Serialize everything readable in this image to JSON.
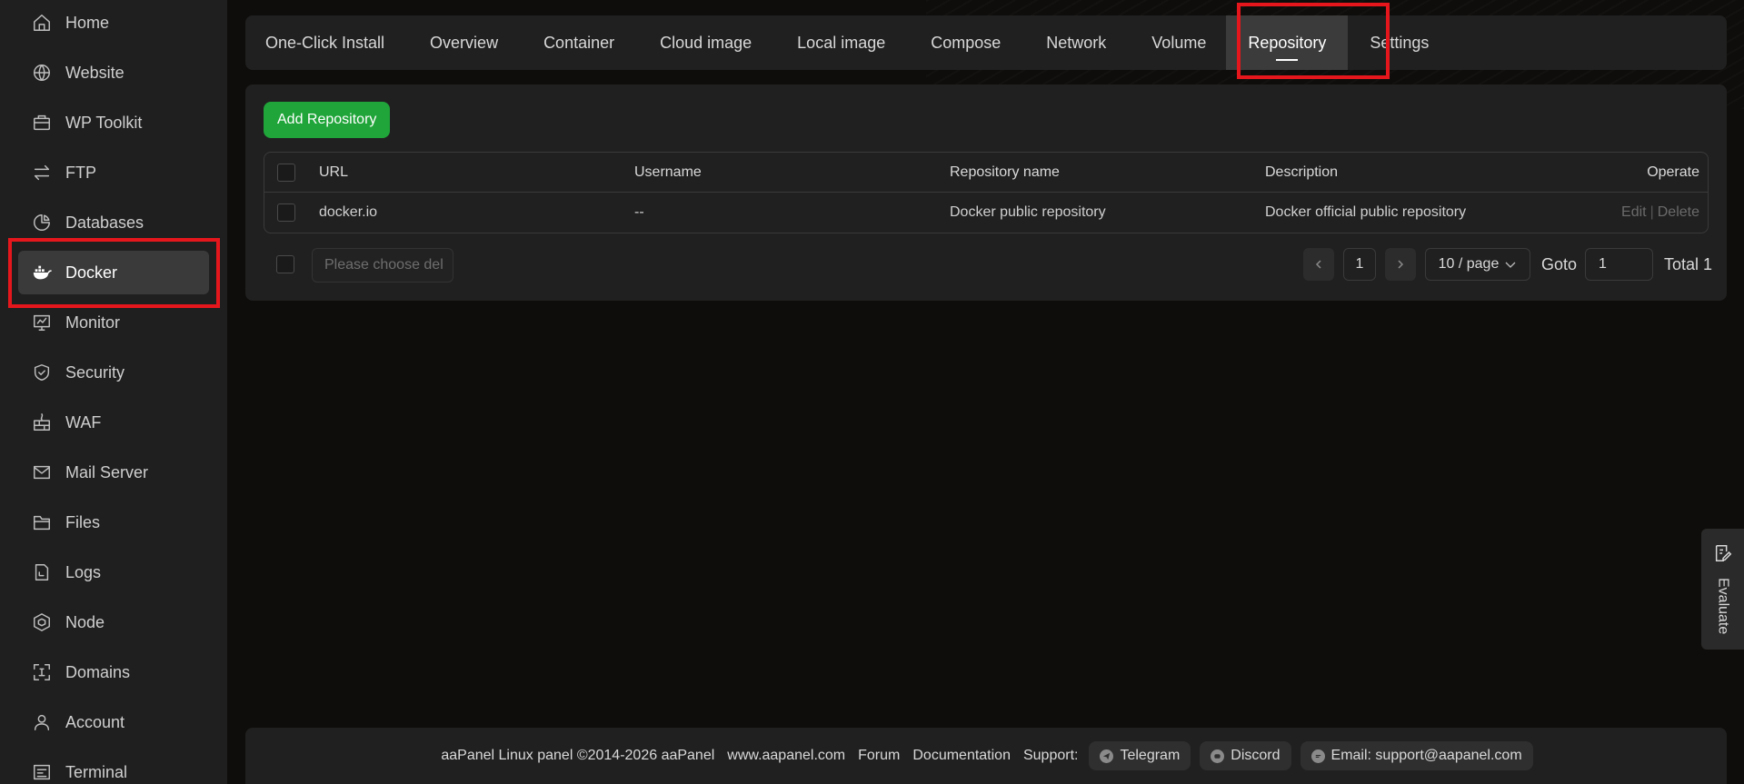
{
  "sidebar": {
    "items": [
      {
        "label": "Home",
        "icon": "home-icon"
      },
      {
        "label": "Website",
        "icon": "globe-icon"
      },
      {
        "label": "WP Toolkit",
        "icon": "toolkit-icon"
      },
      {
        "label": "FTP",
        "icon": "transfer-icon"
      },
      {
        "label": "Databases",
        "icon": "database-icon"
      },
      {
        "label": "Docker",
        "icon": "docker-icon"
      },
      {
        "label": "Monitor",
        "icon": "monitor-icon"
      },
      {
        "label": "Security",
        "icon": "shield-icon"
      },
      {
        "label": "WAF",
        "icon": "firewall-icon"
      },
      {
        "label": "Mail Server",
        "icon": "mail-icon"
      },
      {
        "label": "Files",
        "icon": "folder-icon"
      },
      {
        "label": "Logs",
        "icon": "logs-icon"
      },
      {
        "label": "Node",
        "icon": "node-icon"
      },
      {
        "label": "Domains",
        "icon": "domains-icon"
      },
      {
        "label": "Account",
        "icon": "user-icon"
      },
      {
        "label": "Terminal",
        "icon": "terminal-icon"
      }
    ],
    "active": "Docker"
  },
  "tabs": [
    "One-Click Install",
    "Overview",
    "Container",
    "Cloud image",
    "Local image",
    "Compose",
    "Network",
    "Volume",
    "Repository",
    "Settings"
  ],
  "active_tab": "Repository",
  "toolbar": {
    "add_label": "Add Repository"
  },
  "table": {
    "headers": {
      "url": "URL",
      "username": "Username",
      "repo_name": "Repository name",
      "description": "Description",
      "operate": "Operate"
    },
    "rows": [
      {
        "url": "docker.io",
        "username": "--",
        "repo_name": "Docker public repository",
        "description": "Docker official public repository",
        "edit": "Edit",
        "delete": "Delete"
      }
    ]
  },
  "batch": {
    "placeholder": "Please choose del"
  },
  "pagination": {
    "page": "1",
    "page_size": "10 / page",
    "goto_label": "Goto",
    "goto_value": "1",
    "total": "Total 1"
  },
  "footer": {
    "copyright": "aaPanel Linux panel ©2014-2026 aaPanel",
    "site": "www.aapanel.com",
    "forum": "Forum",
    "docs": "Documentation",
    "support_label": "Support:",
    "telegram": "Telegram",
    "discord": "Discord",
    "email": "Email: support@aapanel.com"
  },
  "evaluate": {
    "label": "Evaluate"
  },
  "colors": {
    "accent": "#20a53a",
    "highlight": "#e5171c"
  }
}
